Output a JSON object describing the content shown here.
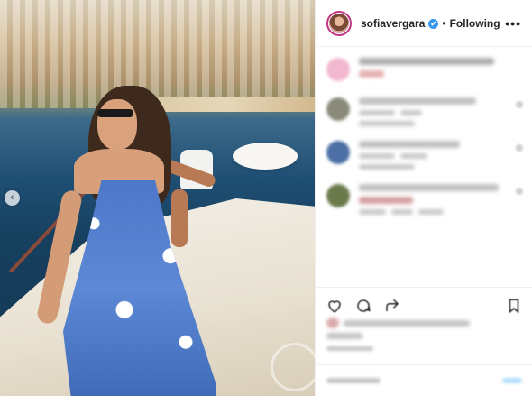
{
  "post": {
    "username": "sofiavergara",
    "verified_icon": "✔",
    "separator": "•",
    "follow_state": "Following",
    "more_icon": "•••",
    "nav_prev_icon": "‹"
  },
  "comments": [
    {
      "avatar_color": "#f2b8cf"
    },
    {
      "avatar_color": "#8a8a7a"
    },
    {
      "avatar_color": "#4d6fa6"
    },
    {
      "avatar_color": "#6a7a4a"
    }
  ],
  "actions": {
    "like_icon": "heart-icon",
    "comment_icon": "comment-icon",
    "share_icon": "share-icon",
    "save_icon": "bookmark-icon"
  }
}
